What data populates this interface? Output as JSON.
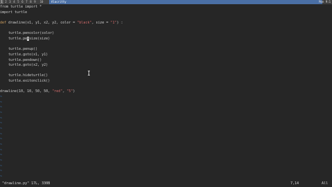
{
  "panel": {
    "workspaces": [
      "1",
      "2",
      "3",
      "4",
      "5",
      "6",
      "7",
      "8",
      "9",
      "10"
    ],
    "active_workspace": 0,
    "window_title": "Alacritty",
    "right_info": "Mon 9:1"
  },
  "editor": {
    "lines": [
      "from turtle import *",
      "import turtle",
      "",
      "def drawline(x1, y1, x2, y2, color = \"black\", size = \"1\") :",
      "",
      "    turtle.pencolor(color)",
      "    turtle.pensize(size)",
      "",
      "    turtle.penup()",
      "    turtle.goto(x1, y1)",
      "    turtle.pendown()",
      "    turtle.goto(x2, y2)",
      "",
      "    turtle.hideturtle()",
      "    turtle.exitonclick()",
      "",
      "drawline(10, 10, 50, 50, \"red\", \"5\")"
    ],
    "tilde_char": "~",
    "tilde_count": 16
  },
  "status": {
    "file_info": "\"drawline.py\" 17L, 330B",
    "cursor_pos": "7,14",
    "scroll": "All"
  },
  "colors": {
    "background": "#262626",
    "tilde": "#3e78b5",
    "string": "#d06a6a",
    "keyword_def": "#d0a060",
    "title_bar": "#4a6fa5"
  }
}
